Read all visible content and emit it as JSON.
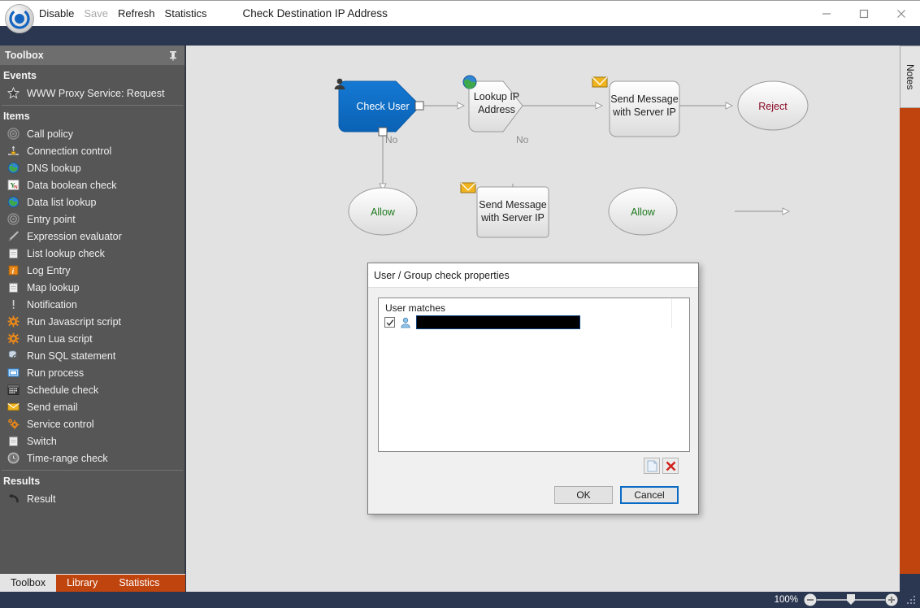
{
  "window": {
    "document_title": "Check Destination IP Address",
    "menu": [
      {
        "label": "Disable",
        "enabled": true
      },
      {
        "label": "Save",
        "enabled": false
      },
      {
        "label": "Refresh",
        "enabled": true
      },
      {
        "label": "Statistics",
        "enabled": true
      }
    ],
    "controls": {
      "minimize": "minimize-icon",
      "maximize": "maximize-icon",
      "close": "close-icon"
    },
    "app_icon": "app-logo-icon"
  },
  "toolbox": {
    "header": "Toolbox",
    "pin_icon": "pin-icon",
    "groups": [
      {
        "title": "Events",
        "items": [
          {
            "label": "WWW Proxy Service: Request",
            "icon": "star-icon"
          }
        ]
      },
      {
        "title": "Items",
        "items": [
          {
            "label": "Call policy",
            "icon": "target-icon"
          },
          {
            "label": "Connection control",
            "icon": "connection-icon"
          },
          {
            "label": "DNS lookup",
            "icon": "globe-icon"
          },
          {
            "label": "Data boolean check",
            "icon": "yn-icon"
          },
          {
            "label": "Data list lookup",
            "icon": "globe-icon"
          },
          {
            "label": "Entry point",
            "icon": "target-icon"
          },
          {
            "label": "Expression evaluator",
            "icon": "pencil-icon"
          },
          {
            "label": "List lookup check",
            "icon": "notepad-icon"
          },
          {
            "label": "Log Entry",
            "icon": "log-info-icon"
          },
          {
            "label": "Map lookup",
            "icon": "notepad-icon"
          },
          {
            "label": "Notification",
            "icon": "exclamation-icon"
          },
          {
            "label": "Run Javascript script",
            "icon": "gear-icon"
          },
          {
            "label": "Run Lua script",
            "icon": "gear-icon"
          },
          {
            "label": "Run SQL statement",
            "icon": "sql-icon"
          },
          {
            "label": "Run process",
            "icon": "process-icon"
          },
          {
            "label": "Schedule check",
            "icon": "calendar-icon"
          },
          {
            "label": "Send email",
            "icon": "envelope-icon"
          },
          {
            "label": "Service control",
            "icon": "service-gear-icon"
          },
          {
            "label": "Switch",
            "icon": "notepad-icon"
          },
          {
            "label": "Time-range check",
            "icon": "clock-icon"
          }
        ]
      },
      {
        "title": "Results",
        "items": [
          {
            "label": "Result",
            "icon": "return-arrow-icon"
          }
        ]
      }
    ],
    "tabs": [
      {
        "label": "Toolbox",
        "active": true
      },
      {
        "label": "Library",
        "active": false
      },
      {
        "label": "Statistics",
        "active": false
      }
    ]
  },
  "notes_panel": {
    "label": "Notes"
  },
  "diagram": {
    "nodes": [
      {
        "id": "check-user",
        "label": "Check User",
        "shape": "pentagon",
        "selected": true,
        "badge": "user-icon"
      },
      {
        "id": "lookup-ip",
        "label_line1": "Lookup IP",
        "label_line2": "Address",
        "shape": "pentagon",
        "badge": "globe-icon"
      },
      {
        "id": "send-msg-top",
        "label_line1": "Send Message",
        "label_line2": "with Server IP",
        "shape": "rect",
        "badge": "envelope-icon"
      },
      {
        "id": "reject",
        "label": "Reject",
        "shape": "ellipse",
        "tone": "reject"
      },
      {
        "id": "allow-left",
        "label": "Allow",
        "shape": "ellipse",
        "tone": "allow"
      },
      {
        "id": "send-msg-bottom",
        "label_line1": "Send Message",
        "label_line2": "with Server IP",
        "shape": "rect",
        "badge": "envelope-icon"
      },
      {
        "id": "allow-right",
        "label": "Allow",
        "shape": "ellipse",
        "tone": "allow"
      }
    ],
    "edge_labels": [
      {
        "id": "check-user-no",
        "text": "No"
      },
      {
        "id": "lookup-ip-no",
        "text": "No"
      }
    ]
  },
  "dialog": {
    "title": "User / Group check properties",
    "list": {
      "header": "User matches",
      "rows": [
        {
          "checked": true,
          "icon": "user-icon",
          "value": "",
          "redacted": true
        }
      ]
    },
    "tool_buttons": [
      {
        "name": "new-item-button",
        "icon": "page-icon"
      },
      {
        "name": "delete-item-button",
        "icon": "red-x-icon"
      }
    ],
    "buttons": [
      {
        "label": "OK",
        "focused": false
      },
      {
        "label": "Cancel",
        "focused": true
      }
    ]
  },
  "statusbar": {
    "zoom_label": "100%",
    "zoom_out_icon": "minus-circle-icon",
    "zoom_in_icon": "plus-circle-icon",
    "grip_icon": "resize-grip-icon"
  },
  "colors": {
    "accent_orange": "#c0440e",
    "selected_node_blue": "#0b6ec8",
    "statusbar_navy": "#2b3650",
    "canvas_gray": "#e2e2e2",
    "sidebar_gray": "#565656"
  }
}
